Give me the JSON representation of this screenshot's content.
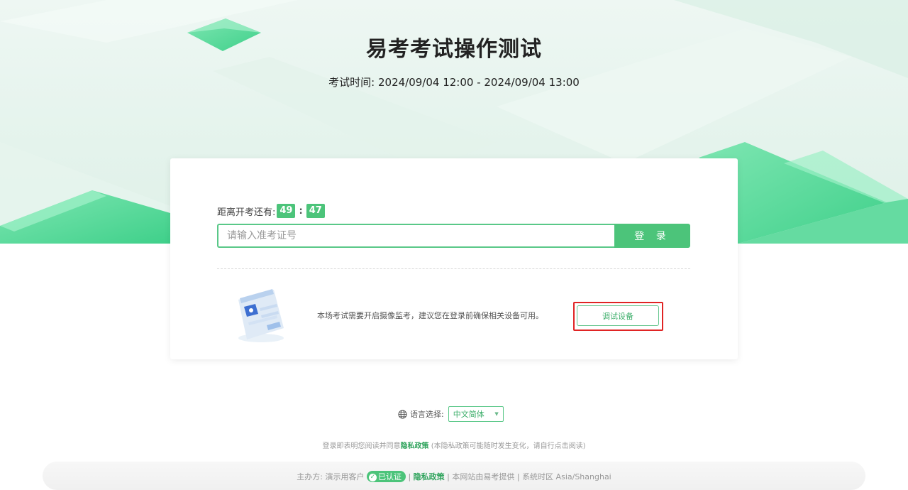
{
  "header": {
    "title": "易考考试操作测试",
    "time_label": "考试时间:",
    "time_range": "2024/09/04 12:00 - 2024/09/04 13:00"
  },
  "login": {
    "countdown_label": "距离开考还有:",
    "minutes": "49",
    "separator": ":",
    "seconds": "47",
    "ticket_placeholder": "请输入准考证号",
    "ticket_value": "",
    "login_button": "登 录"
  },
  "device_check": {
    "tip": "本场考试需要开启摄像监考，建议您在登录前确保相关设备可用。",
    "button": "调试设备"
  },
  "language": {
    "label": "语言选择:",
    "selected": "中文简体",
    "icon": "globe-icon"
  },
  "privacy": {
    "prefix": "登录即表明您阅读并同意",
    "link": "隐私政策",
    "suffix": "(本隐私政策可能随时发生变化，请自行点击阅读)"
  },
  "footer": {
    "host_label": "主办方:",
    "host_name": "演示用客户",
    "verified_badge": "已认证",
    "privacy_link": "隐私政策",
    "provider": "本网站由易考提供",
    "timezone": "系统时区 Asia/Shanghai"
  },
  "colors": {
    "accent": "#4cc47a",
    "highlight_border": "#e02424",
    "link": "#2fa35c"
  }
}
